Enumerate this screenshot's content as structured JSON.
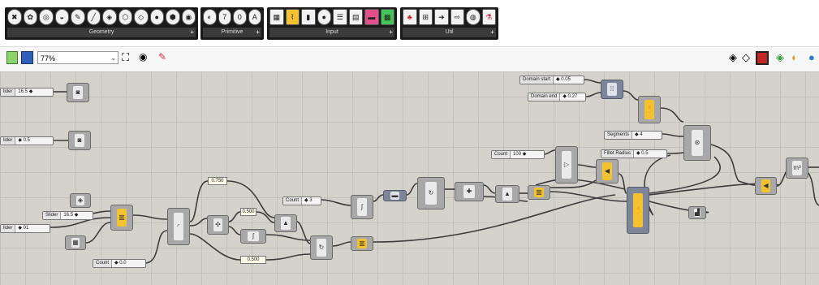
{
  "ribbon": {
    "groups": [
      {
        "label": "Geometry",
        "plus": "+"
      },
      {
        "label": "Primitive",
        "plus": "+"
      },
      {
        "label": "Input",
        "plus": "+"
      },
      {
        "label": "Util",
        "plus": "+"
      }
    ]
  },
  "toolbar": {
    "zoom_value": "77%"
  },
  "canvas": {
    "sliders": [
      {
        "name": "lider",
        "value": "16.5 ◆"
      },
      {
        "name": "lider",
        "value": "◆ 0.5"
      },
      {
        "name": "Slider",
        "value": "16.5 ◆"
      },
      {
        "name": "lider",
        "value": "◆ 01"
      },
      {
        "name": "Count",
        "value": "◆ 0.0"
      },
      {
        "name": "Count",
        "value": "◆ 3"
      },
      {
        "name": "Count",
        "value": "100 ◆"
      },
      {
        "name": "Domain start",
        "value": "◆ 0.05"
      },
      {
        "name": "Domain end",
        "value": "◆ 0.27"
      },
      {
        "name": "Segments",
        "value": "◆ 4"
      },
      {
        "name": "Fillet Radius",
        "value": "◆ 0.5"
      }
    ],
    "panels": [
      "0.750",
      "0.500",
      "0.500"
    ]
  }
}
